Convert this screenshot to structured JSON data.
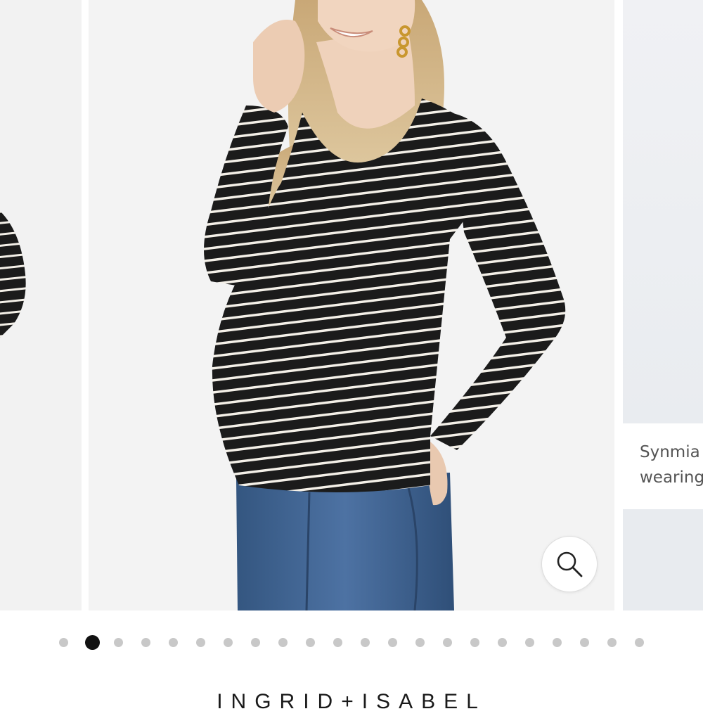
{
  "gallery": {
    "next_slide_caption": [
      "Synmia",
      "wearing"
    ],
    "zoom_icon": "search-icon",
    "dots": {
      "count": 22,
      "active_index": 1
    }
  },
  "brand": {
    "name": "INGRID+ISABEL"
  },
  "colors": {
    "stripe_dark": "#1b1b1b",
    "stripe_light": "#f4f0e8",
    "denim": "#3d5f8c",
    "active_dot": "#111111",
    "inactive_dot": "#c8c8c8"
  }
}
